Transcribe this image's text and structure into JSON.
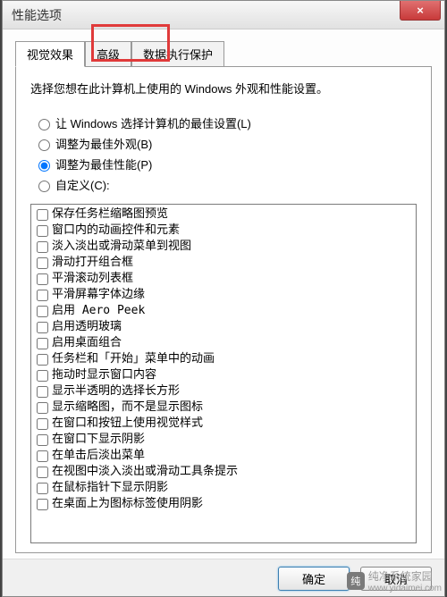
{
  "window": {
    "title": "性能选项",
    "close": "×"
  },
  "tabs": {
    "visual": "视觉效果",
    "advanced": "高级",
    "dep": "数据执行保护"
  },
  "description": "选择您想在此计算机上使用的 Windows 外观和性能设置。",
  "radios": {
    "auto": "让 Windows 选择计算机的最佳设置(L)",
    "best_look": "调整为最佳外观(B)",
    "best_perf": "调整为最佳性能(P)",
    "custom": "自定义(C):",
    "selected": "best_perf"
  },
  "options": [
    "保存任务栏缩略图预览",
    "窗口内的动画控件和元素",
    "淡入淡出或滑动菜单到视图",
    "滑动打开组合框",
    "平滑滚动列表框",
    "平滑屏幕字体边缘",
    "启用 Aero Peek",
    "启用透明玻璃",
    "启用桌面组合",
    "任务栏和「开始」菜单中的动画",
    "拖动时显示窗口内容",
    "显示半透明的选择长方形",
    "显示缩略图，而不是显示图标",
    "在窗口和按钮上使用视觉样式",
    "在窗口下显示阴影",
    "在单击后淡出菜单",
    "在视图中淡入淡出或滑动工具条提示",
    "在鼠标指针下显示阴影",
    "在桌面上为图标标签使用阴影"
  ],
  "buttons": {
    "ok": "确定",
    "cancel": "取消"
  },
  "watermark": {
    "badge": "纯",
    "line1": "纯净系统家园",
    "line2": "www.yidaimei.com"
  }
}
